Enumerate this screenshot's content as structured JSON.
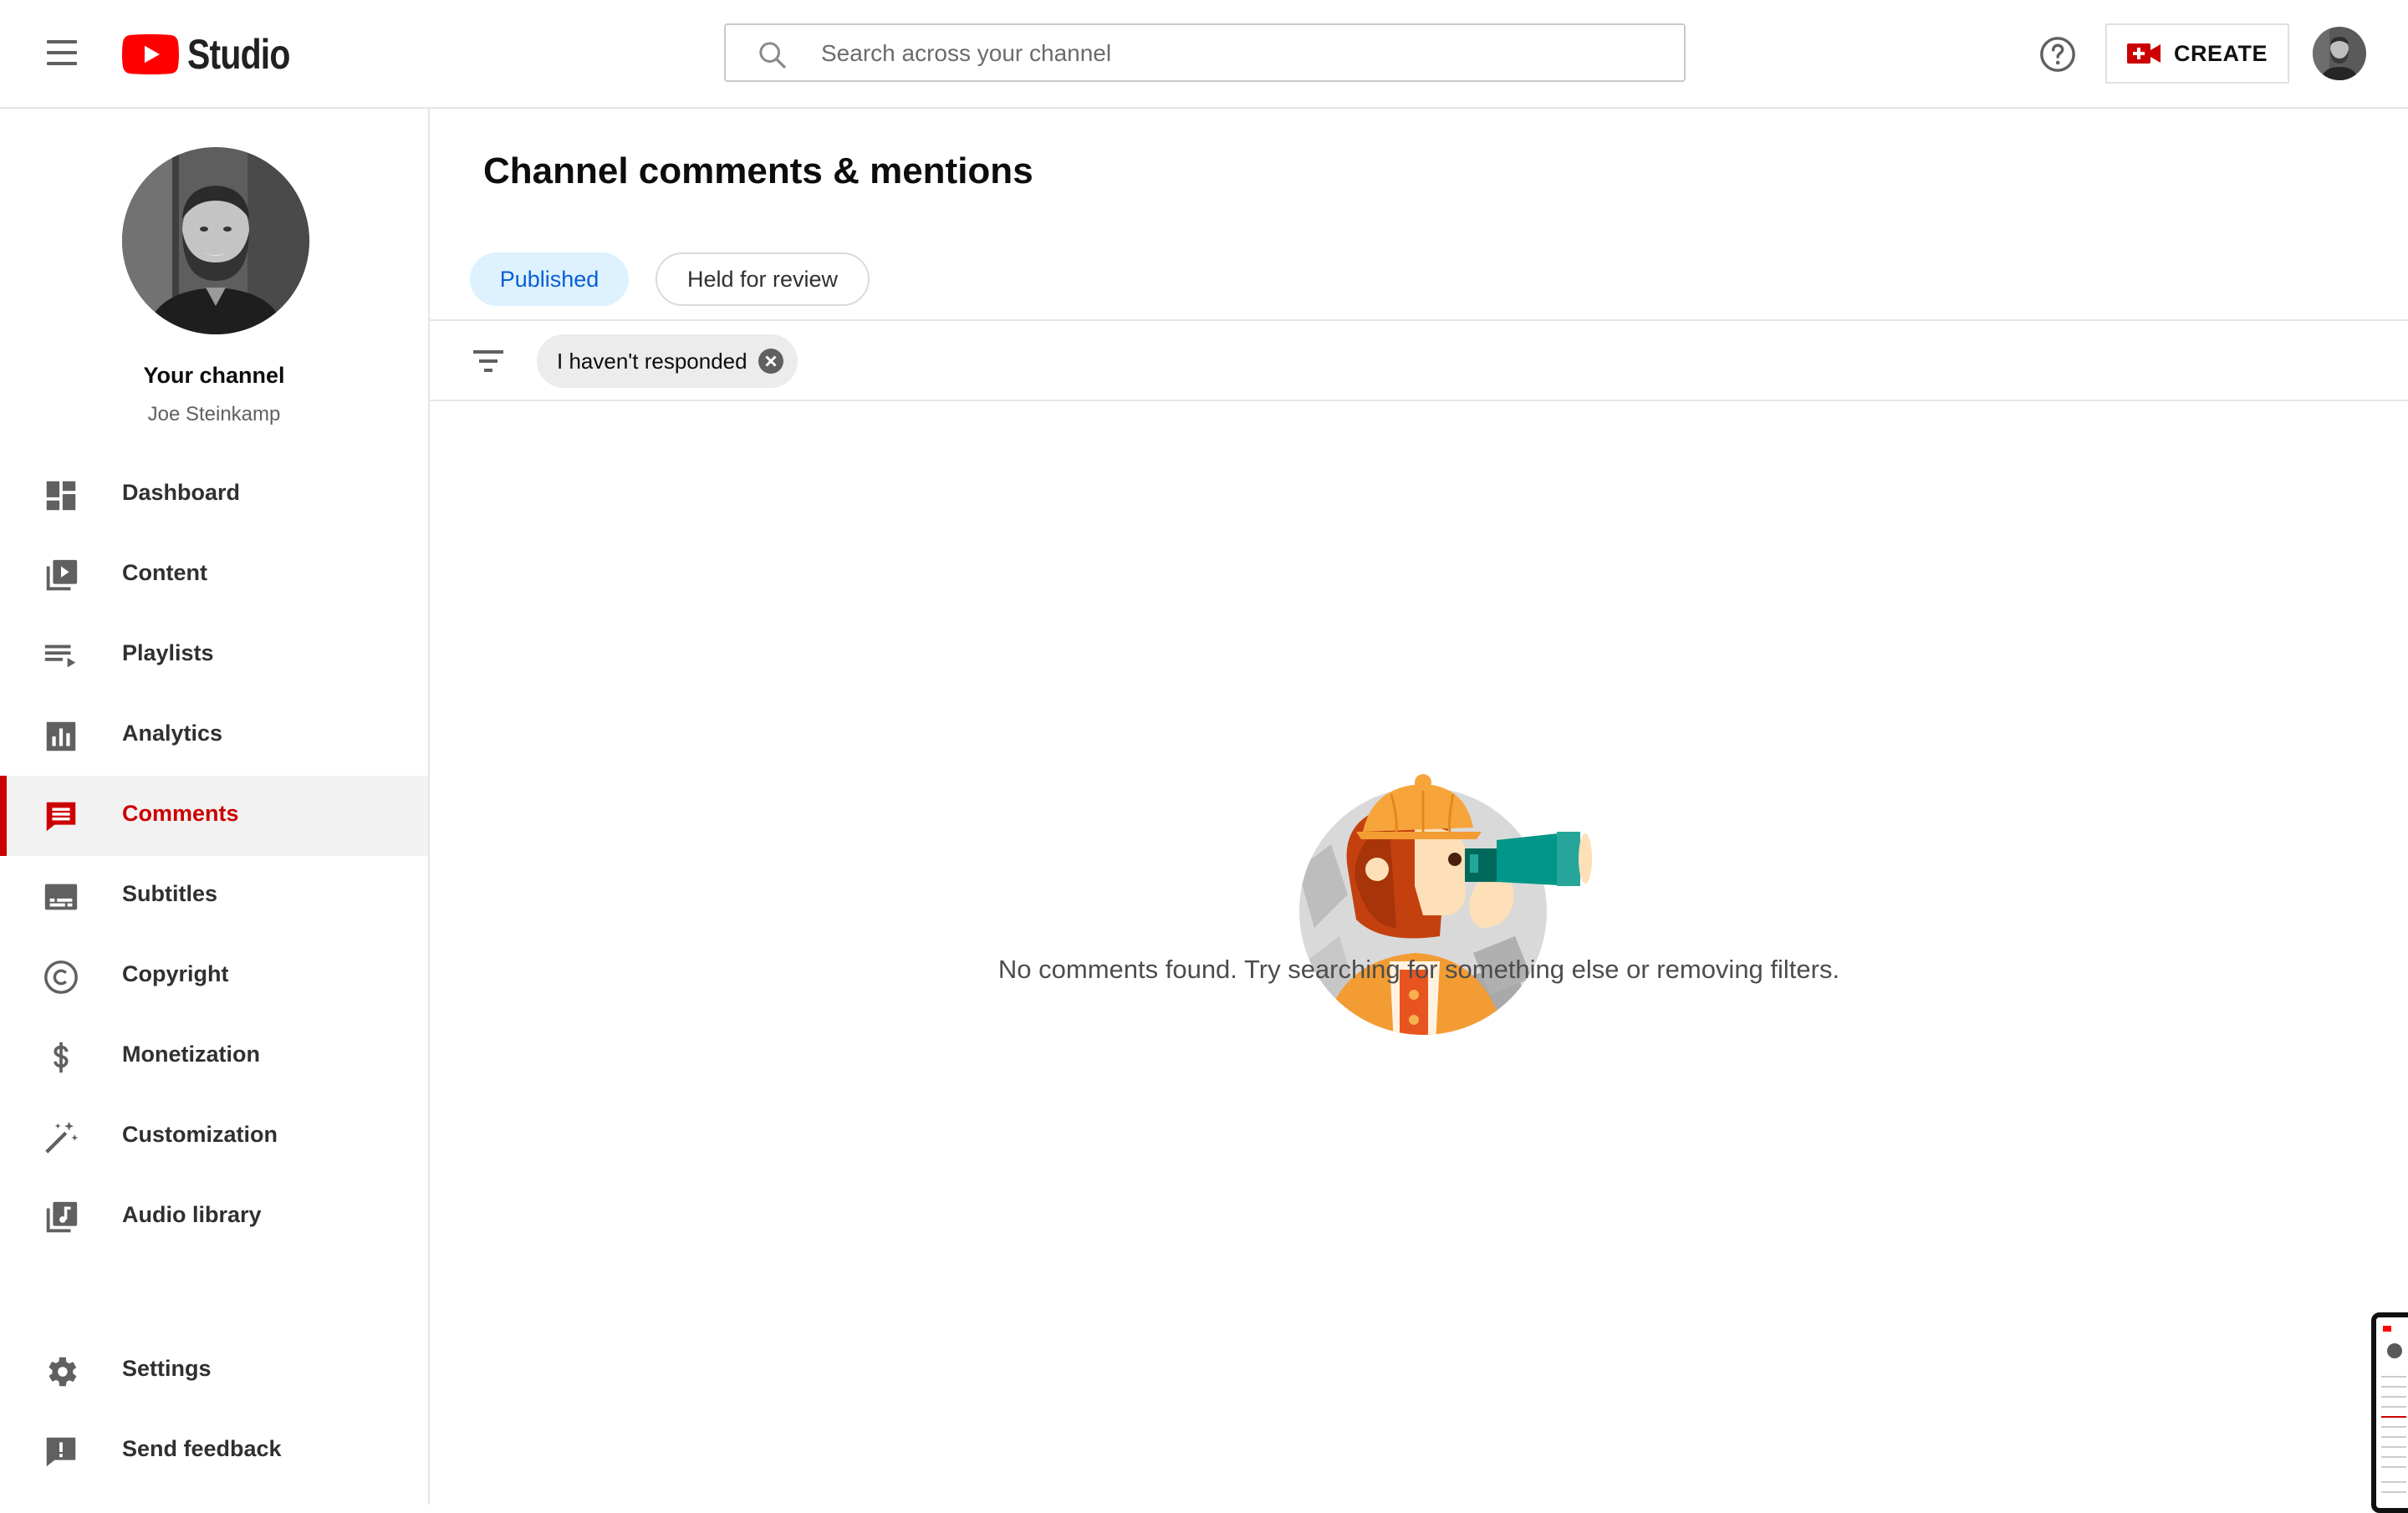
{
  "header": {
    "logo_text": "Studio",
    "search_placeholder": "Search across your channel",
    "create_label": "CREATE"
  },
  "sidebar": {
    "channel_title": "Your channel",
    "channel_name": "Joe Steinkamp",
    "items": [
      {
        "label": "Dashboard",
        "icon": "dashboard-icon"
      },
      {
        "label": "Content",
        "icon": "content-icon"
      },
      {
        "label": "Playlists",
        "icon": "playlists-icon"
      },
      {
        "label": "Analytics",
        "icon": "analytics-icon"
      },
      {
        "label": "Comments",
        "icon": "comments-icon",
        "active": true
      },
      {
        "label": "Subtitles",
        "icon": "subtitles-icon"
      },
      {
        "label": "Copyright",
        "icon": "copyright-icon"
      },
      {
        "label": "Monetization",
        "icon": "dollar-icon"
      },
      {
        "label": "Customization",
        "icon": "magic-wand-icon"
      },
      {
        "label": "Audio library",
        "icon": "audio-library-icon"
      }
    ],
    "bottom_items": [
      {
        "label": "Settings",
        "icon": "gear-icon"
      },
      {
        "label": "Send feedback",
        "icon": "feedback-icon"
      }
    ]
  },
  "main": {
    "title": "Channel comments & mentions",
    "tabs": [
      {
        "label": "Published",
        "selected": true
      },
      {
        "label": "Held for review",
        "selected": false
      }
    ],
    "filter_chip": "I haven't responded",
    "empty_message": "No comments found. Try searching for something else or removing filters."
  },
  "colors": {
    "accent_red": "#cc0000",
    "tab_selected_bg": "#def1ff",
    "tab_selected_text": "#065fd4"
  }
}
